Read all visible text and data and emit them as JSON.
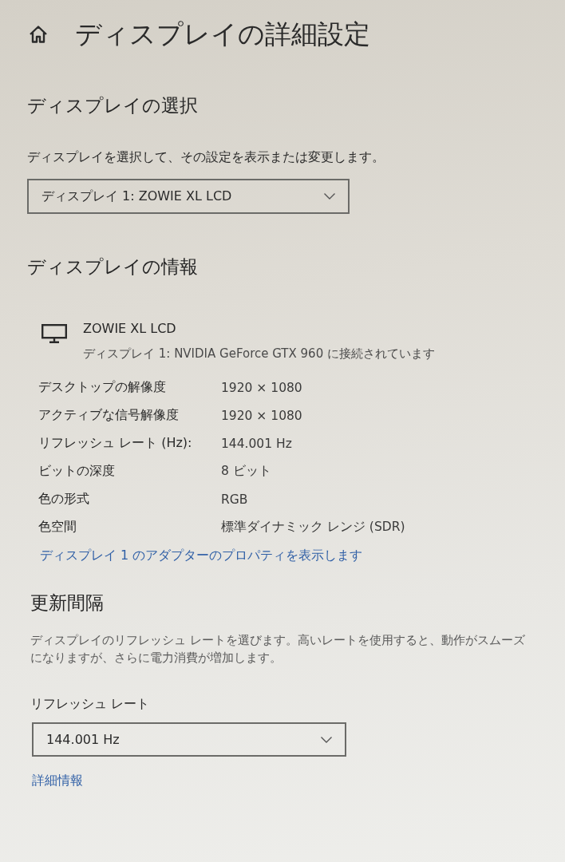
{
  "header": {
    "title": "ディスプレイの詳細設定"
  },
  "display_selection": {
    "heading": "ディスプレイの選択",
    "description": "ディスプレイを選択して、その設定を表示または変更します。",
    "dropdown": {
      "value": "ディスプレイ 1: ZOWIE XL LCD"
    }
  },
  "display_info": {
    "heading": "ディスプレイの情報",
    "monitor": {
      "name": "ZOWIE XL LCD",
      "connection": "ディスプレイ 1: NVIDIA GeForce GTX 960 に接続されています"
    },
    "rows": [
      {
        "label": "デスクトップの解像度",
        "value": "1920 × 1080"
      },
      {
        "label": "アクティブな信号解像度",
        "value": "1920 × 1080"
      },
      {
        "label": "リフレッシュ レート (Hz):",
        "value": "144.001 Hz"
      },
      {
        "label": "ビットの深度",
        "value": "8 ビット"
      },
      {
        "label": "色の形式",
        "value": "RGB"
      },
      {
        "label": "色空間",
        "value": "標準ダイナミック レンジ (SDR)"
      }
    ],
    "link": "ディスプレイ 1 のアダプターのプロパティを表示します"
  },
  "refresh_interval": {
    "heading": "更新間隔",
    "description": "ディスプレイのリフレッシュ レートを選びます。高いレートを使用すると、動作がスムーズになりますが、さらに電力消費が増加します。",
    "field_label": "リフレッシュ レート",
    "dropdown": {
      "value": "144.001 Hz"
    },
    "link": "詳細情報"
  }
}
